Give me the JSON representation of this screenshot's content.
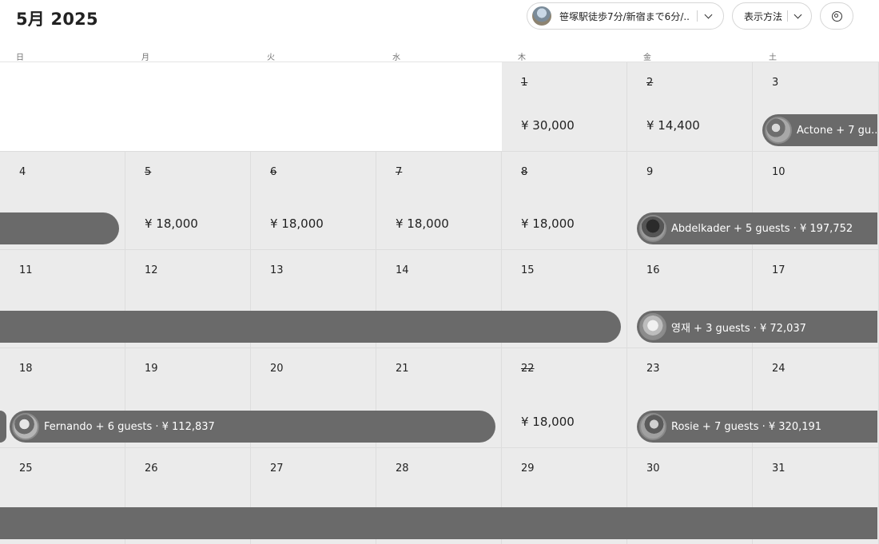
{
  "header": {
    "month_title": "5月 2025",
    "listing_name": "笹塚駅徒歩7分/新宿まで6分/...",
    "view_label": "表示方法"
  },
  "weekdays": [
    "日",
    "月",
    "火",
    "水",
    "木",
    "金",
    "土"
  ],
  "weeks": [
    {
      "days": [
        {
          "empty": true
        },
        {
          "empty": true
        },
        {
          "empty": true
        },
        {
          "empty": true
        },
        {
          "date": "1",
          "blocked": true,
          "price": "¥ 30,000"
        },
        {
          "date": "2",
          "blocked": true,
          "price": "¥ 14,400"
        },
        {
          "date": "3"
        }
      ]
    },
    {
      "days": [
        {
          "date": "4"
        },
        {
          "date": "5",
          "blocked": true,
          "price": "¥ 18,000"
        },
        {
          "date": "6",
          "blocked": true,
          "price": "¥ 18,000"
        },
        {
          "date": "7",
          "blocked": true,
          "price": "¥ 18,000"
        },
        {
          "date": "8",
          "blocked": true,
          "price": "¥ 18,000"
        },
        {
          "date": "9"
        },
        {
          "date": "10"
        }
      ]
    },
    {
      "days": [
        {
          "date": "11"
        },
        {
          "date": "12"
        },
        {
          "date": "13"
        },
        {
          "date": "14"
        },
        {
          "date": "15"
        },
        {
          "date": "16"
        },
        {
          "date": "17"
        }
      ]
    },
    {
      "days": [
        {
          "date": "18"
        },
        {
          "date": "19"
        },
        {
          "date": "20"
        },
        {
          "date": "21"
        },
        {
          "date": "22",
          "blocked": true,
          "price": "¥ 18,000"
        },
        {
          "date": "23"
        },
        {
          "date": "24"
        }
      ]
    },
    {
      "days": [
        {
          "date": "25"
        },
        {
          "date": "26"
        },
        {
          "date": "27"
        },
        {
          "date": "28"
        },
        {
          "date": "29"
        },
        {
          "date": "30"
        },
        {
          "date": "31"
        }
      ]
    }
  ],
  "reservations": [
    {
      "week": 0,
      "start": 6,
      "end": 6,
      "cut_left": false,
      "cut_right": true,
      "label": "Actone + 7 gu...",
      "avatar": "av1"
    },
    {
      "week": 1,
      "start": 0,
      "end": 0,
      "cut_left": true,
      "cut_right": false,
      "label": "",
      "avatar": ""
    },
    {
      "week": 1,
      "start": 5,
      "end": 6,
      "cut_left": false,
      "cut_right": true,
      "label": "Abdelkader + 5 guests · ¥ 197,752",
      "avatar": "av2"
    },
    {
      "week": 2,
      "start": 0,
      "end": 4,
      "cut_left": true,
      "cut_right": false,
      "label": "",
      "avatar": ""
    },
    {
      "week": 2,
      "start": 5,
      "end": 6,
      "cut_left": false,
      "cut_right": true,
      "label": "영재 + 3 guests · ¥ 72,037",
      "avatar": "av3"
    },
    {
      "week": 3,
      "start": 0,
      "end": 0,
      "cut_left": true,
      "cut_right": false,
      "label": "",
      "avatar": "",
      "stub": true
    },
    {
      "week": 3,
      "start": 0,
      "end": 3,
      "cut_left": false,
      "cut_right": false,
      "label": "Fernando + 6 guests · ¥ 112,837",
      "avatar": "av4"
    },
    {
      "week": 3,
      "start": 5,
      "end": 6,
      "cut_left": false,
      "cut_right": true,
      "label": "Rosie + 7 guests · ¥ 320,191",
      "avatar": "av5"
    },
    {
      "week": 4,
      "start": 0,
      "end": 6,
      "cut_left": true,
      "cut_right": true,
      "label": "",
      "avatar": ""
    }
  ]
}
